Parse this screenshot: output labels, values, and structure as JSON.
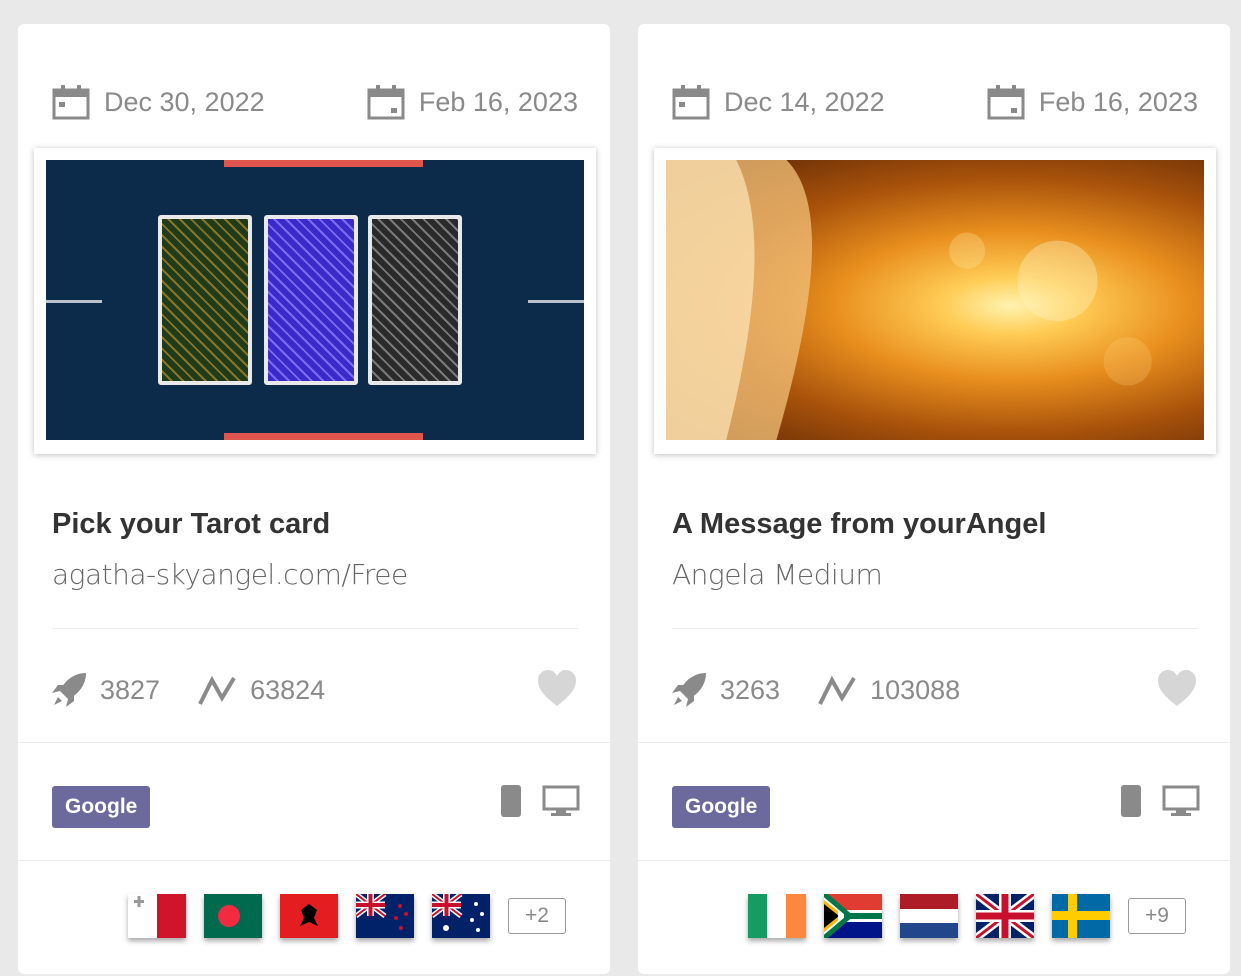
{
  "cards": [
    {
      "start_date": "Dec 30, 2022",
      "end_date": "Feb 16, 2023",
      "image_desc_icon": "tarot-cards-image",
      "title": "Pick your Tarot card",
      "subtitle": "agatha-skyangel.com/Free",
      "launches": "3827",
      "views": "63824",
      "network": "Google",
      "more_countries": "+2",
      "flags": [
        "malta",
        "bangladesh",
        "albania",
        "new-zealand",
        "australia"
      ]
    },
    {
      "start_date": "Dec 14, 2022",
      "end_date": "Feb 16, 2023",
      "image_desc_icon": "angel-wings-image",
      "title": "A Message from yourAngel",
      "subtitle": "Angela Medium",
      "launches": "3263",
      "views": "103088",
      "network": "Google",
      "more_countries": "+9",
      "flags": [
        "ireland",
        "south-africa",
        "netherlands",
        "united-kingdom",
        "sweden"
      ]
    }
  ],
  "colors": {
    "badge": "#6c6a9c",
    "muted_text": "#8a8a8a",
    "heart": "#d6d6d6",
    "tarot_bg": "#0c2a4a",
    "tarot_accent": "#e0564d"
  }
}
